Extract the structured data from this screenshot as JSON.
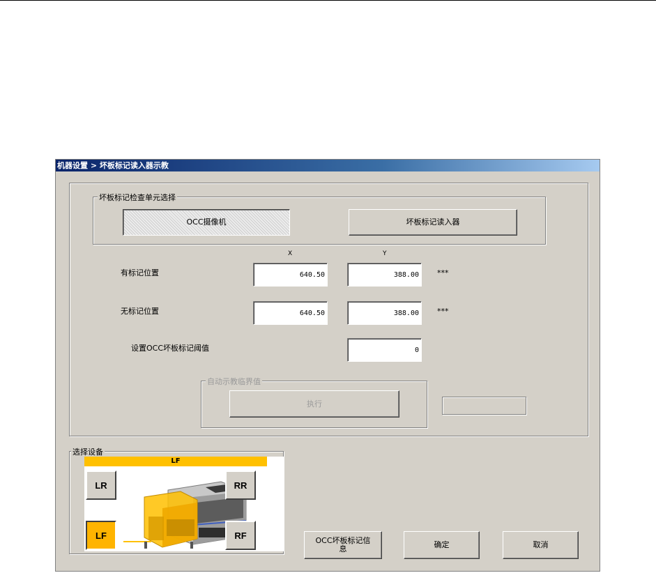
{
  "window": {
    "title": "机器设置 > 坏板标记读入器示教"
  },
  "unit_select": {
    "legend": "坏板标记检查单元选择",
    "ocr_camera_label": "OCC摄像机",
    "reader_label": "坏板标记读入器"
  },
  "columns": {
    "x": "X",
    "y": "Y"
  },
  "mark_present": {
    "label": "有标记位置",
    "x": "640.50",
    "y": "388.00",
    "status": "***"
  },
  "mark_absent": {
    "label": "无标记位置",
    "x": "640.50",
    "y": "388.00",
    "status": "***"
  },
  "threshold": {
    "label": "设置OCC坏板标记阈值",
    "value": "0"
  },
  "auto_teach": {
    "legend": "自动示教临界值",
    "execute_label": "执行"
  },
  "device_select": {
    "legend": "选择设备",
    "selected": "LF",
    "buttons": {
      "lr": "LR",
      "rr": "RR",
      "lf": "LF",
      "rf": "RF"
    }
  },
  "footer": {
    "occ_info_label": "OCC坏板标记信息",
    "ok_label": "确定",
    "cancel_label": "取消"
  },
  "colors": {
    "selected_device": "#ffb400",
    "title_bar": "#0a246a"
  }
}
